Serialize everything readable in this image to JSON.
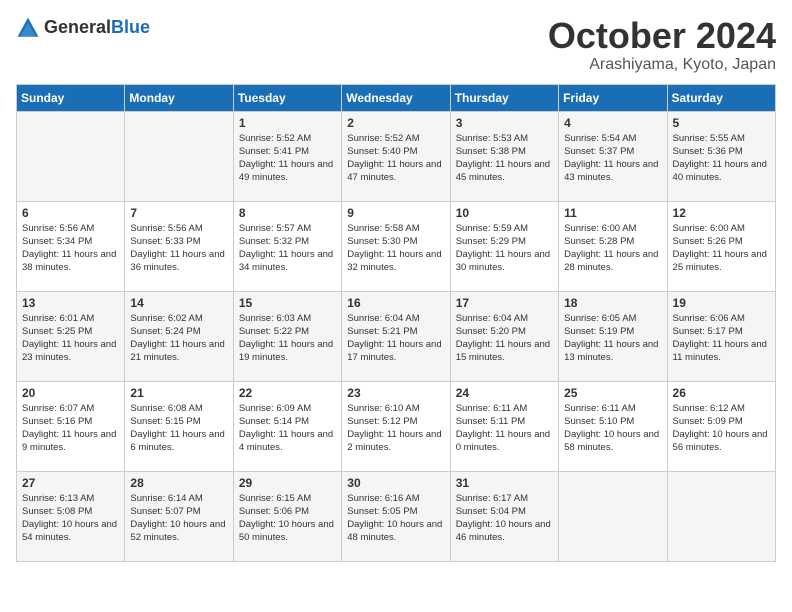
{
  "logo": {
    "general": "General",
    "blue": "Blue"
  },
  "title": "October 2024",
  "location": "Arashiyama, Kyoto, Japan",
  "weekdays": [
    "Sunday",
    "Monday",
    "Tuesday",
    "Wednesday",
    "Thursday",
    "Friday",
    "Saturday"
  ],
  "weeks": [
    [
      {
        "day": "",
        "info": ""
      },
      {
        "day": "",
        "info": ""
      },
      {
        "day": "1",
        "info": "Sunrise: 5:52 AM\nSunset: 5:41 PM\nDaylight: 11 hours and 49 minutes."
      },
      {
        "day": "2",
        "info": "Sunrise: 5:52 AM\nSunset: 5:40 PM\nDaylight: 11 hours and 47 minutes."
      },
      {
        "day": "3",
        "info": "Sunrise: 5:53 AM\nSunset: 5:38 PM\nDaylight: 11 hours and 45 minutes."
      },
      {
        "day": "4",
        "info": "Sunrise: 5:54 AM\nSunset: 5:37 PM\nDaylight: 11 hours and 43 minutes."
      },
      {
        "day": "5",
        "info": "Sunrise: 5:55 AM\nSunset: 5:36 PM\nDaylight: 11 hours and 40 minutes."
      }
    ],
    [
      {
        "day": "6",
        "info": "Sunrise: 5:56 AM\nSunset: 5:34 PM\nDaylight: 11 hours and 38 minutes."
      },
      {
        "day": "7",
        "info": "Sunrise: 5:56 AM\nSunset: 5:33 PM\nDaylight: 11 hours and 36 minutes."
      },
      {
        "day": "8",
        "info": "Sunrise: 5:57 AM\nSunset: 5:32 PM\nDaylight: 11 hours and 34 minutes."
      },
      {
        "day": "9",
        "info": "Sunrise: 5:58 AM\nSunset: 5:30 PM\nDaylight: 11 hours and 32 minutes."
      },
      {
        "day": "10",
        "info": "Sunrise: 5:59 AM\nSunset: 5:29 PM\nDaylight: 11 hours and 30 minutes."
      },
      {
        "day": "11",
        "info": "Sunrise: 6:00 AM\nSunset: 5:28 PM\nDaylight: 11 hours and 28 minutes."
      },
      {
        "day": "12",
        "info": "Sunrise: 6:00 AM\nSunset: 5:26 PM\nDaylight: 11 hours and 25 minutes."
      }
    ],
    [
      {
        "day": "13",
        "info": "Sunrise: 6:01 AM\nSunset: 5:25 PM\nDaylight: 11 hours and 23 minutes."
      },
      {
        "day": "14",
        "info": "Sunrise: 6:02 AM\nSunset: 5:24 PM\nDaylight: 11 hours and 21 minutes."
      },
      {
        "day": "15",
        "info": "Sunrise: 6:03 AM\nSunset: 5:22 PM\nDaylight: 11 hours and 19 minutes."
      },
      {
        "day": "16",
        "info": "Sunrise: 6:04 AM\nSunset: 5:21 PM\nDaylight: 11 hours and 17 minutes."
      },
      {
        "day": "17",
        "info": "Sunrise: 6:04 AM\nSunset: 5:20 PM\nDaylight: 11 hours and 15 minutes."
      },
      {
        "day": "18",
        "info": "Sunrise: 6:05 AM\nSunset: 5:19 PM\nDaylight: 11 hours and 13 minutes."
      },
      {
        "day": "19",
        "info": "Sunrise: 6:06 AM\nSunset: 5:17 PM\nDaylight: 11 hours and 11 minutes."
      }
    ],
    [
      {
        "day": "20",
        "info": "Sunrise: 6:07 AM\nSunset: 5:16 PM\nDaylight: 11 hours and 9 minutes."
      },
      {
        "day": "21",
        "info": "Sunrise: 6:08 AM\nSunset: 5:15 PM\nDaylight: 11 hours and 6 minutes."
      },
      {
        "day": "22",
        "info": "Sunrise: 6:09 AM\nSunset: 5:14 PM\nDaylight: 11 hours and 4 minutes."
      },
      {
        "day": "23",
        "info": "Sunrise: 6:10 AM\nSunset: 5:12 PM\nDaylight: 11 hours and 2 minutes."
      },
      {
        "day": "24",
        "info": "Sunrise: 6:11 AM\nSunset: 5:11 PM\nDaylight: 11 hours and 0 minutes."
      },
      {
        "day": "25",
        "info": "Sunrise: 6:11 AM\nSunset: 5:10 PM\nDaylight: 10 hours and 58 minutes."
      },
      {
        "day": "26",
        "info": "Sunrise: 6:12 AM\nSunset: 5:09 PM\nDaylight: 10 hours and 56 minutes."
      }
    ],
    [
      {
        "day": "27",
        "info": "Sunrise: 6:13 AM\nSunset: 5:08 PM\nDaylight: 10 hours and 54 minutes."
      },
      {
        "day": "28",
        "info": "Sunrise: 6:14 AM\nSunset: 5:07 PM\nDaylight: 10 hours and 52 minutes."
      },
      {
        "day": "29",
        "info": "Sunrise: 6:15 AM\nSunset: 5:06 PM\nDaylight: 10 hours and 50 minutes."
      },
      {
        "day": "30",
        "info": "Sunrise: 6:16 AM\nSunset: 5:05 PM\nDaylight: 10 hours and 48 minutes."
      },
      {
        "day": "31",
        "info": "Sunrise: 6:17 AM\nSunset: 5:04 PM\nDaylight: 10 hours and 46 minutes."
      },
      {
        "day": "",
        "info": ""
      },
      {
        "day": "",
        "info": ""
      }
    ]
  ]
}
